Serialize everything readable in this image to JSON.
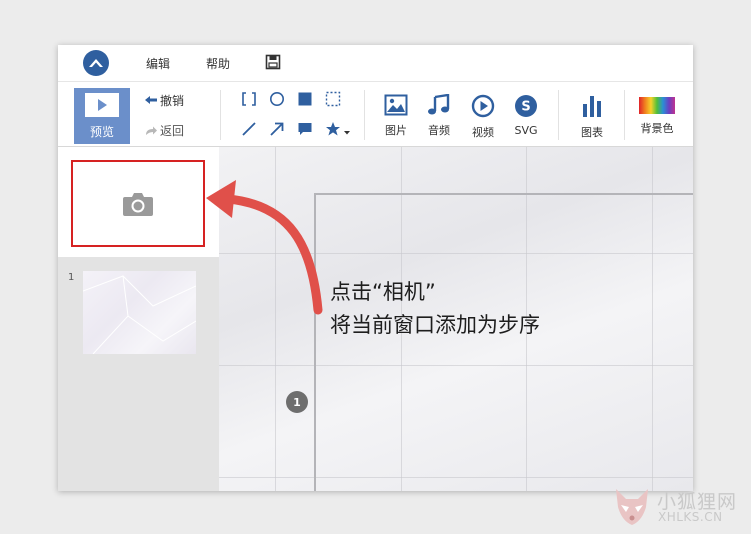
{
  "menubar": {
    "items": [
      "编辑",
      "帮助"
    ]
  },
  "toolbar": {
    "preview_label": "预览",
    "undo_label": "撤销",
    "redo_label": "返回",
    "media": [
      {
        "label": "图片",
        "icon": "image-icon"
      },
      {
        "label": "音频",
        "icon": "music-icon"
      },
      {
        "label": "视频",
        "icon": "video-play-icon"
      },
      {
        "label": "SVG",
        "icon": "svg-icon"
      },
      {
        "label": "图表",
        "icon": "bar-chart-icon"
      },
      {
        "label": "背景色",
        "icon": "color-gradient-icon"
      }
    ],
    "shapes": [
      "bracket-frame-icon",
      "circle-icon",
      "square-icon",
      "dashed-select-icon",
      "line-icon",
      "arrow-icon",
      "speech-bubble-icon",
      "star-icon"
    ]
  },
  "slides": {
    "items": [
      {
        "number": "1"
      }
    ]
  },
  "canvas": {
    "step_marker": "1"
  },
  "annotation": {
    "line1": "点击“相机”",
    "line2": "将当前窗口添加为步序"
  },
  "watermark": {
    "cn": "小狐狸网",
    "en": "XHLKS.CN"
  },
  "colors": {
    "accent": "#6b8fca",
    "logo": "#2f5f9f",
    "icon": "#2f5f9f",
    "highlight": "#d62222",
    "arrow": "#e0504a"
  }
}
